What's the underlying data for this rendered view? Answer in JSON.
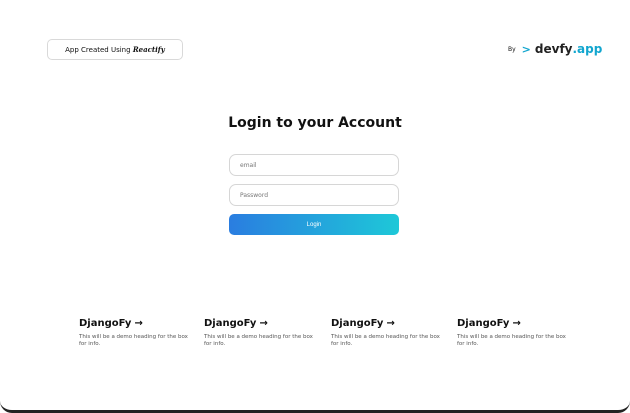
{
  "header": {
    "badge_prefix": "App Created Using",
    "badge_brand": "Reactify",
    "by_label": "By",
    "logo_chevron": ">",
    "logo_name": "devfy",
    "logo_tld": ".app"
  },
  "login": {
    "title": "Login to your Account",
    "email_placeholder": "email",
    "password_placeholder": "Password",
    "button_label": "Login"
  },
  "cards": [
    {
      "title": "DjangoFy",
      "arrow": "→",
      "description": "This will be a demo heading for the box for info."
    },
    {
      "title": "DjangoFy",
      "arrow": "→",
      "description": "This will be a demo heading for the box for info."
    },
    {
      "title": "DjangoFy",
      "arrow": "→",
      "description": "This will be a demo heading for the box for info."
    },
    {
      "title": "DjangoFy",
      "arrow": "→",
      "description": "This will be a demo heading for the box for info."
    }
  ],
  "colors": {
    "accent": "#12a6cf",
    "button_gradient_start": "#2a7de0",
    "button_gradient_end": "#1ec8d8"
  }
}
